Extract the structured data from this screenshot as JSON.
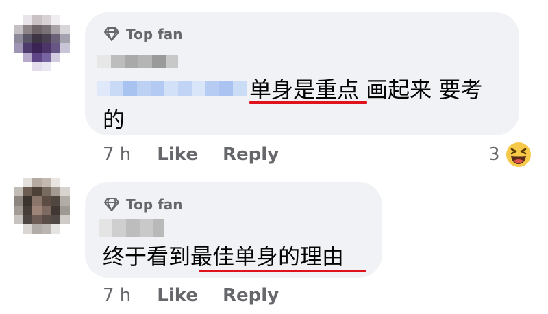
{
  "comments": [
    {
      "badge_label": "Top fan",
      "text_line1": "单身是重点 画起来 要考",
      "text_line2": "的",
      "time": "7 h",
      "like_label": "Like",
      "reply_label": "Reply",
      "reaction_count": "3",
      "reaction_icon": "laughing-emoji-icon"
    },
    {
      "badge_label": "Top fan",
      "text_line1": "终于看到最佳单身的理由",
      "time": "7 h",
      "like_label": "Like",
      "reply_label": "Reply"
    }
  ],
  "colors": {
    "bubble": "#f0f2f5",
    "underline": "#e0121b",
    "meta_text": "#65676b",
    "reaction_yellow": "#f7c948"
  }
}
